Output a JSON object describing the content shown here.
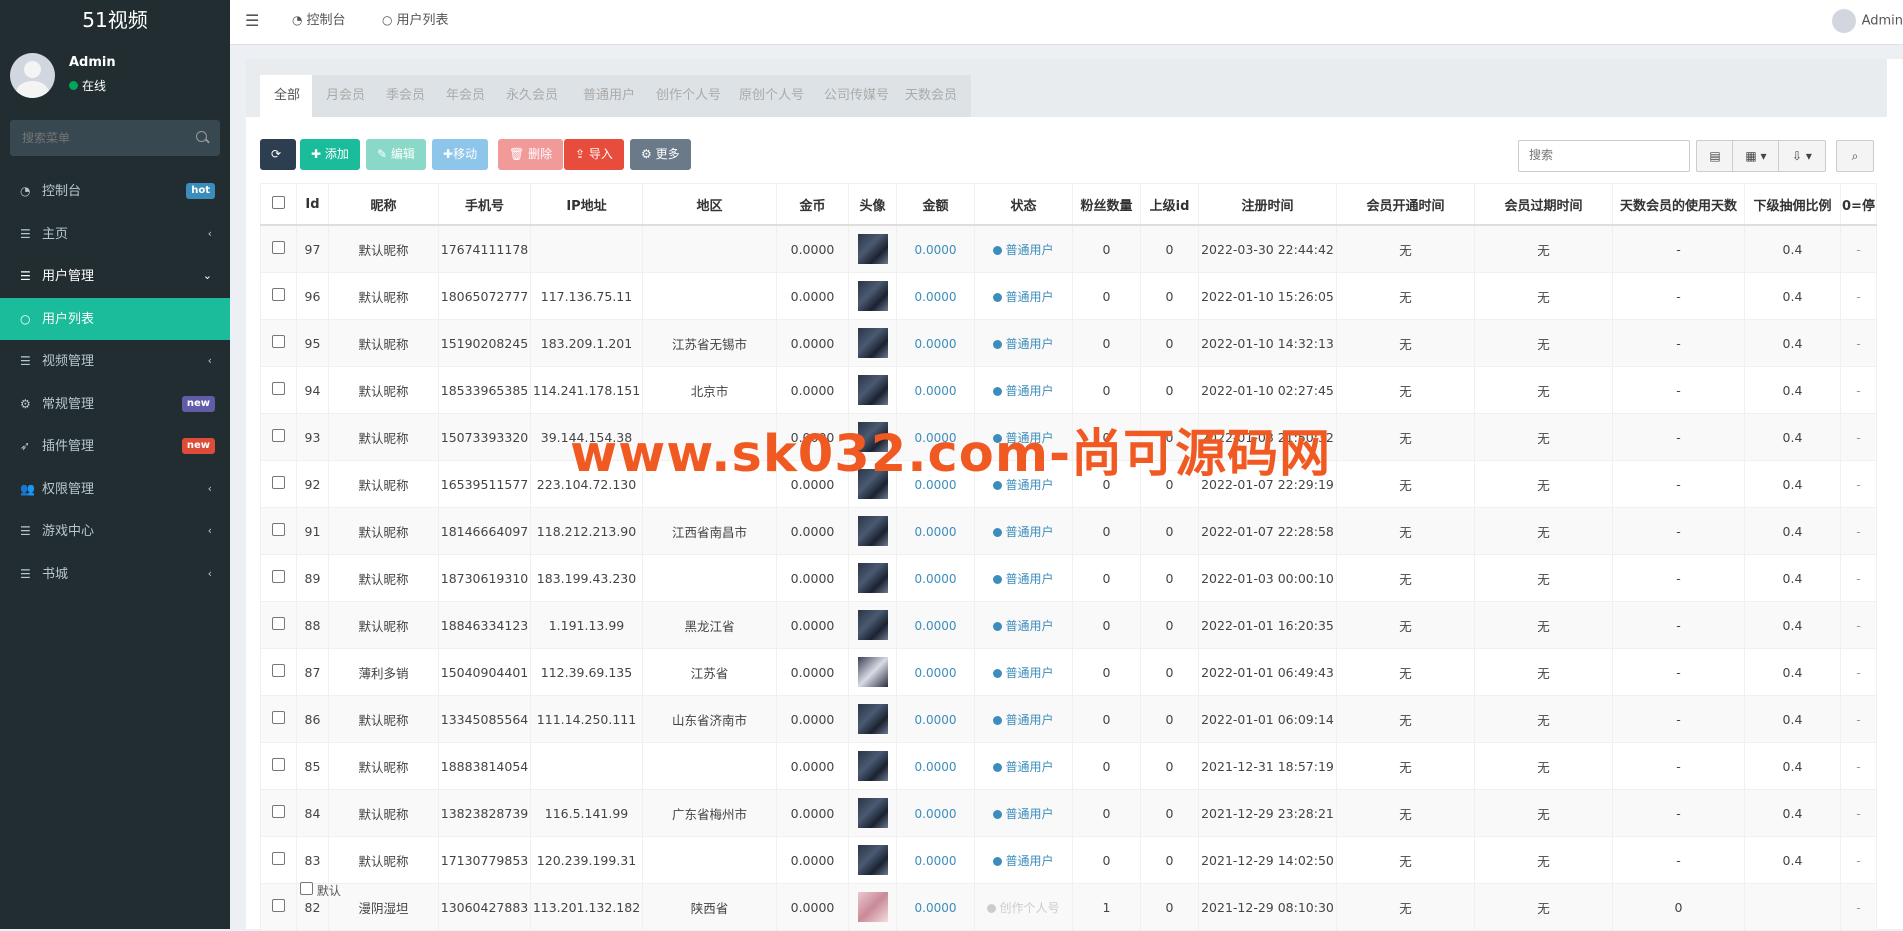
{
  "app": {
    "title": "51视频"
  },
  "user": {
    "name": "Admin",
    "status": "在线"
  },
  "sidebar_search": {
    "placeholder": "搜索菜单"
  },
  "menu": [
    {
      "label": "控制台",
      "icon": "dashboard-icon",
      "badge": "hot",
      "badge_color": "#3c8dbc"
    },
    {
      "label": "主页",
      "icon": "list-icon",
      "chevron": "‹"
    },
    {
      "label": "用户管理",
      "icon": "list-icon",
      "chevron": "⌄"
    },
    {
      "label": "用户列表",
      "icon": "circle-icon"
    },
    {
      "label": "视频管理",
      "icon": "list-icon",
      "chevron": "‹"
    },
    {
      "label": "常规管理",
      "icon": "cogs-icon",
      "badge": "new",
      "badge_color": "#605ca8"
    },
    {
      "label": "插件管理",
      "icon": "rocket-icon",
      "badge": "new",
      "badge_color": "#dd4b39"
    },
    {
      "label": "权限管理",
      "icon": "users-icon",
      "chevron": "‹"
    },
    {
      "label": "游戏中心",
      "icon": "list-icon",
      "chevron": "‹"
    },
    {
      "label": "书城",
      "icon": "list-icon",
      "chevron": "‹"
    }
  ],
  "topbar": {
    "tabs": [
      {
        "label": "控制台",
        "icon": "dashboard-icon"
      },
      {
        "label": "用户列表",
        "icon": "circle-icon"
      }
    ],
    "user": "Admin"
  },
  "filter_tabs": [
    "全部",
    "月会员",
    "季会员",
    "年会员",
    "永久会员",
    "普通用户",
    "创作个人号",
    "原创个人号",
    "公司传媒号",
    "天数会员"
  ],
  "toolbar": {
    "refresh": "",
    "add": "添加",
    "edit": "编辑",
    "move": "移动",
    "delete": "删除",
    "import": "导入",
    "more": "更多"
  },
  "colors": {
    "add": "#1abc9c",
    "edit": "#8ad9c8",
    "move": "#8ec5ea",
    "delete": "#f2999a",
    "import": "#e74c3c",
    "more": "#6a7a89",
    "refresh": "#2c3e50"
  },
  "table_search": {
    "placeholder": "搜索"
  },
  "columns": [
    "",
    "Id",
    "昵称",
    "手机号",
    "IP地址",
    "地区",
    "金币",
    "头像",
    "金额",
    "状态",
    "粉丝数量",
    "上级id",
    "注册时间",
    "会员开通时间",
    "会员过期时间",
    "天数会员的使用天数",
    "下级抽佣比例",
    "0=停"
  ],
  "rows": [
    [
      "97",
      "默认昵称",
      "17674111178",
      "",
      "",
      "0.0000",
      "0.0000",
      "普通用户",
      "0",
      "0",
      "2022-03-30 22:44:42",
      "无",
      "无",
      "-",
      "0.4"
    ],
    [
      "96",
      "默认昵称",
      "18065072777",
      "117.136.75.11",
      "",
      "0.0000",
      "0.0000",
      "普通用户",
      "0",
      "0",
      "2022-01-10 15:26:05",
      "无",
      "无",
      "-",
      "0.4"
    ],
    [
      "95",
      "默认昵称",
      "15190208245",
      "183.209.1.201",
      "江苏省无锡市",
      "0.0000",
      "0.0000",
      "普通用户",
      "0",
      "0",
      "2022-01-10 14:32:13",
      "无",
      "无",
      "-",
      "0.4"
    ],
    [
      "94",
      "默认昵称",
      "18533965385",
      "114.241.178.151",
      "北京市",
      "0.0000",
      "0.0000",
      "普通用户",
      "0",
      "0",
      "2022-01-10 02:27:45",
      "无",
      "无",
      "-",
      "0.4"
    ],
    [
      "93",
      "默认昵称",
      "15073393320",
      "39.144.154.38",
      "",
      "0.0000",
      "0.0000",
      "普通用户",
      "0",
      "0",
      "2022-01-08 21:50:32",
      "无",
      "无",
      "-",
      "0.4"
    ],
    [
      "92",
      "默认昵称",
      "16539511577",
      "223.104.72.130",
      "",
      "0.0000",
      "0.0000",
      "普通用户",
      "0",
      "0",
      "2022-01-07 22:29:19",
      "无",
      "无",
      "-",
      "0.4"
    ],
    [
      "91",
      "默认昵称",
      "18146664097",
      "118.212.213.90",
      "江西省南昌市",
      "0.0000",
      "0.0000",
      "普通用户",
      "0",
      "0",
      "2022-01-07 22:28:58",
      "无",
      "无",
      "-",
      "0.4"
    ],
    [
      "89",
      "默认昵称",
      "18730619310",
      "183.199.43.230",
      "",
      "0.0000",
      "0.0000",
      "普通用户",
      "0",
      "0",
      "2022-01-03 00:00:10",
      "无",
      "无",
      "-",
      "0.4"
    ],
    [
      "88",
      "默认昵称",
      "18846334123",
      "1.191.13.99",
      "黑龙江省",
      "0.0000",
      "0.0000",
      "普通用户",
      "0",
      "0",
      "2022-01-01 16:20:35",
      "无",
      "无",
      "-",
      "0.4"
    ],
    [
      "87",
      "薄利多销",
      "15040904401",
      "112.39.69.135",
      "江苏省",
      "0.0000",
      "0.0000",
      "普通用户",
      "0",
      "0",
      "2022-01-01 06:49:43",
      "无",
      "无",
      "-",
      "0.4"
    ],
    [
      "86",
      "默认昵称",
      "13345085564",
      "111.14.250.111",
      "山东省济南市",
      "0.0000",
      "0.0000",
      "普通用户",
      "0",
      "0",
      "2022-01-01 06:09:14",
      "无",
      "无",
      "-",
      "0.4"
    ],
    [
      "85",
      "默认昵称",
      "18883814054",
      "",
      "",
      "0.0000",
      "0.0000",
      "普通用户",
      "0",
      "0",
      "2021-12-31 18:57:19",
      "无",
      "无",
      "-",
      "0.4"
    ],
    [
      "84",
      "默认昵称",
      "13823828739",
      "116.5.141.99",
      "广东省梅州市",
      "0.0000",
      "0.0000",
      "普通用户",
      "0",
      "0",
      "2021-12-29 23:28:21",
      "无",
      "无",
      "-",
      "0.4"
    ],
    [
      "83",
      "默认昵称",
      "17130779853",
      "120.239.199.31",
      "",
      "0.0000",
      "0.0000",
      "普通用户",
      "0",
      "0",
      "2021-12-29 14:02:50",
      "无",
      "无",
      "-",
      "0.4"
    ],
    [
      "82",
      "漫阴湿坦",
      "13060427883",
      "113.201.132.182",
      "陕西省",
      "0.0000",
      "0.0000",
      "创作个人号",
      "1",
      "0",
      "2021-12-29 08:10:30",
      "无",
      "无",
      "0",
      ""
    ]
  ],
  "overlap_label": "默认",
  "watermark": "www.sk032.com-尚可源码网"
}
